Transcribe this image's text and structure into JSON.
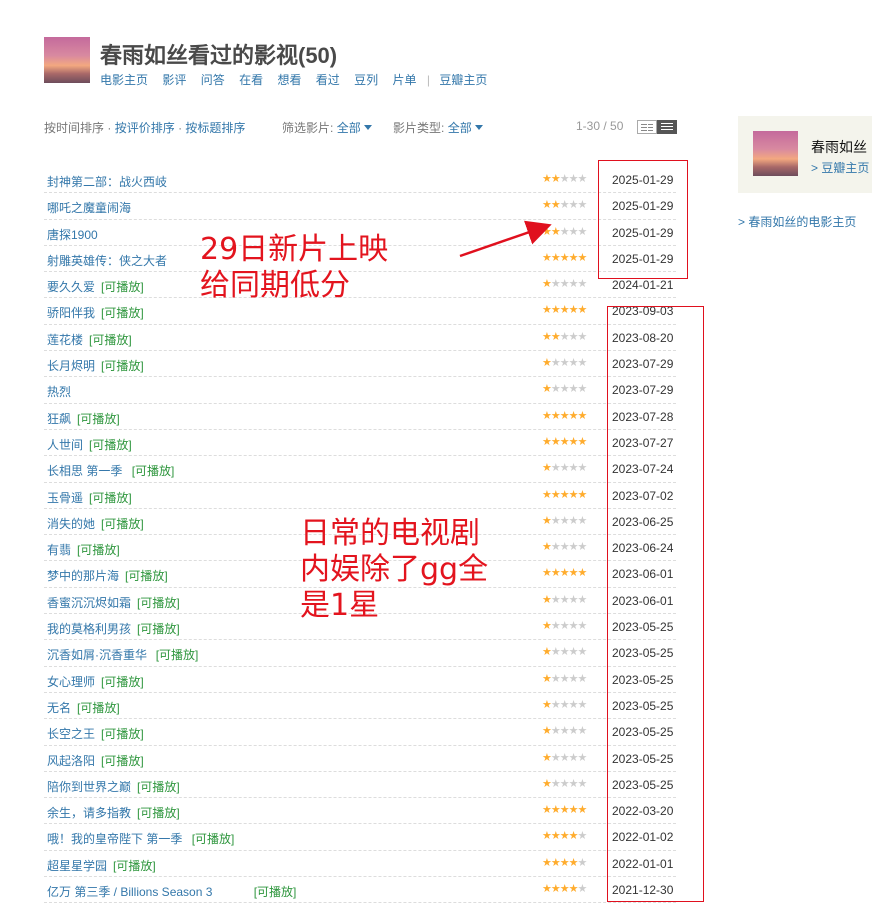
{
  "header": {
    "title": "春雨如丝看过的影视(50)",
    "nav": [
      "电影主页",
      "影评",
      "问答",
      "在看",
      "想看",
      "看过",
      "豆列",
      "片单"
    ],
    "nav_extra": "豆瓣主页",
    "separator": "|"
  },
  "toolbar": {
    "sort_time": "按时间排序",
    "dot": "·",
    "sort_rating": "按评价排序",
    "sort_title": "按标题排序",
    "filter_label": "筛选影片:",
    "filter_value": "全部",
    "type_label": "影片类型:",
    "type_value": "全部",
    "pager": "1-30 / 50"
  },
  "movies": [
    {
      "title": "封神第二部：战火西岐",
      "tag": "",
      "rating": 2,
      "date": "2025-01-29"
    },
    {
      "title": "哪吒之魔童闹海",
      "tag": "",
      "rating": 2,
      "date": "2025-01-29"
    },
    {
      "title": "唐探1900",
      "tag": "",
      "rating": 2,
      "date": "2025-01-29"
    },
    {
      "title": "射雕英雄传：侠之大者",
      "tag": "",
      "rating": 5,
      "date": "2025-01-29"
    },
    {
      "title": "要久久爱",
      "tag": "[可播放]",
      "rating": 1,
      "date": "2024-01-21"
    },
    {
      "title": "骄阳伴我",
      "tag": "[可播放]",
      "rating": 5,
      "date": "2023-09-03"
    },
    {
      "title": "莲花楼",
      "tag": "[可播放]",
      "rating": 2,
      "date": "2023-08-20"
    },
    {
      "title": "长月烬明",
      "tag": "[可播放]",
      "rating": 1,
      "date": "2023-07-29"
    },
    {
      "title": "热烈",
      "tag": "",
      "rating": 1,
      "date": "2023-07-29"
    },
    {
      "title": "狂飙",
      "tag": "[可播放]",
      "rating": 5,
      "date": "2023-07-28"
    },
    {
      "title": "人世间",
      "tag": "[可播放]",
      "rating": 5,
      "date": "2023-07-27"
    },
    {
      "title": "长相思 第一季",
      "tag": "[可播放]",
      "rating": 1,
      "date": "2023-07-24"
    },
    {
      "title": "玉骨遥",
      "tag": "[可播放]",
      "rating": 5,
      "date": "2023-07-02"
    },
    {
      "title": "消失的她",
      "tag": "[可播放]",
      "rating": 1,
      "date": "2023-06-25"
    },
    {
      "title": "有翡",
      "tag": "[可播放]",
      "rating": 1,
      "date": "2023-06-24"
    },
    {
      "title": "梦中的那片海",
      "tag": "[可播放]",
      "rating": 5,
      "date": "2023-06-01"
    },
    {
      "title": "香蜜沉沉烬如霜",
      "tag": "[可播放]",
      "rating": 1,
      "date": "2023-06-01"
    },
    {
      "title": "我的莫格利男孩",
      "tag": "[可播放]",
      "rating": 1,
      "date": "2023-05-25"
    },
    {
      "title": "沉香如屑·沉香重华",
      "tag": "[可播放]",
      "rating": 1,
      "date": "2023-05-25"
    },
    {
      "title": "女心理师",
      "tag": "[可播放]",
      "rating": 1,
      "date": "2023-05-25"
    },
    {
      "title": "无名",
      "tag": "[可播放]",
      "rating": 1,
      "date": "2023-05-25"
    },
    {
      "title": "长空之王",
      "tag": "[可播放]",
      "rating": 1,
      "date": "2023-05-25"
    },
    {
      "title": "风起洛阳",
      "tag": "[可播放]",
      "rating": 1,
      "date": "2023-05-25"
    },
    {
      "title": "陪你到世界之巅",
      "tag": "[可播放]",
      "rating": 1,
      "date": "2023-05-25"
    },
    {
      "title": "余生，请多指教",
      "tag": "[可播放]",
      "rating": 5,
      "date": "2022-03-20"
    },
    {
      "title": "哦！我的皇帝陛下 第一季",
      "tag": "[可播放]",
      "rating": 4,
      "date": "2022-01-02"
    },
    {
      "title": "超星星学园",
      "tag": "[可播放]",
      "rating": 4,
      "date": "2022-01-01"
    },
    {
      "title": "亿万 第三季 / Billions Season 3",
      "tag": "[可播放]",
      "rating": 4,
      "date": "2021-12-30"
    }
  ],
  "annotations": {
    "note1_line1": "29日新片上映",
    "note1_line2": "给同期低分",
    "note2_line1": "日常的电视剧",
    "note2_line2": "内娱除了gg全",
    "note2_line3": "是1星",
    "color": "#e3141e"
  },
  "sidebar": {
    "name": "春雨如丝",
    "link": "> 豆瓣主页",
    "main_link": "> 春雨如丝的电影主页"
  },
  "colors": {
    "link": "#3377aa",
    "playable": "#2e963d",
    "star": "#ffac2d",
    "star_off": "#cccccc",
    "annotation": "#e0101e"
  }
}
